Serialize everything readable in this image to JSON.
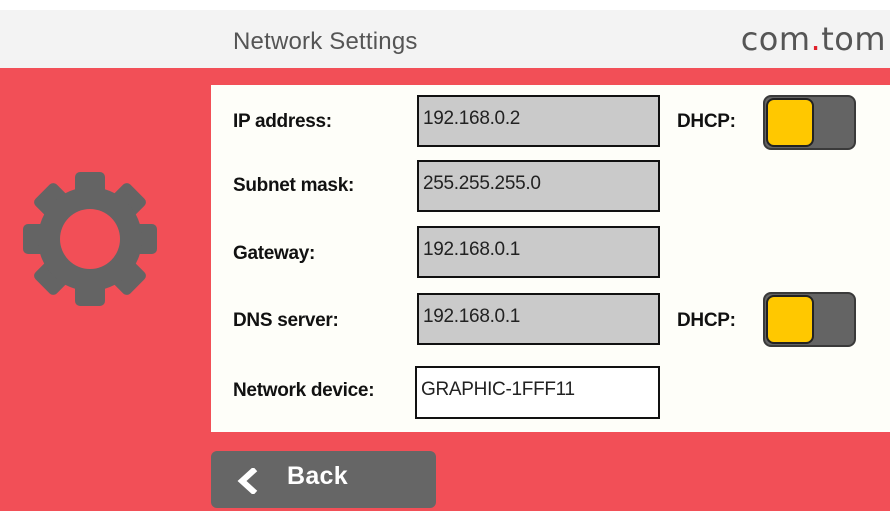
{
  "header": {
    "title": "Network Settings",
    "logo_prefix": "com",
    "logo_dot": ".",
    "logo_suffix": "tom"
  },
  "colors": {
    "background": "#f24f57",
    "panel": "#fefef9",
    "toggle_on": "#ffc800",
    "back_button": "#666666"
  },
  "icons": {
    "settings": "gear-icon",
    "back": "chevron-left-icon"
  },
  "form": {
    "ip": {
      "label": "IP address:",
      "value": "192.168.0.2"
    },
    "subnet": {
      "label": "Subnet mask:",
      "value": "255.255.255.0"
    },
    "gateway": {
      "label": "Gateway:",
      "value": "192.168.0.1"
    },
    "dns": {
      "label": "DNS server:",
      "value": "192.168.0.1"
    },
    "device": {
      "label": "Network device:",
      "value": "GRAPHIC-1FFF11"
    }
  },
  "dhcp": {
    "ip": {
      "label": "DHCP:"
    },
    "dns": {
      "label": "DHCP:"
    }
  },
  "back_button": {
    "label": "Back"
  }
}
